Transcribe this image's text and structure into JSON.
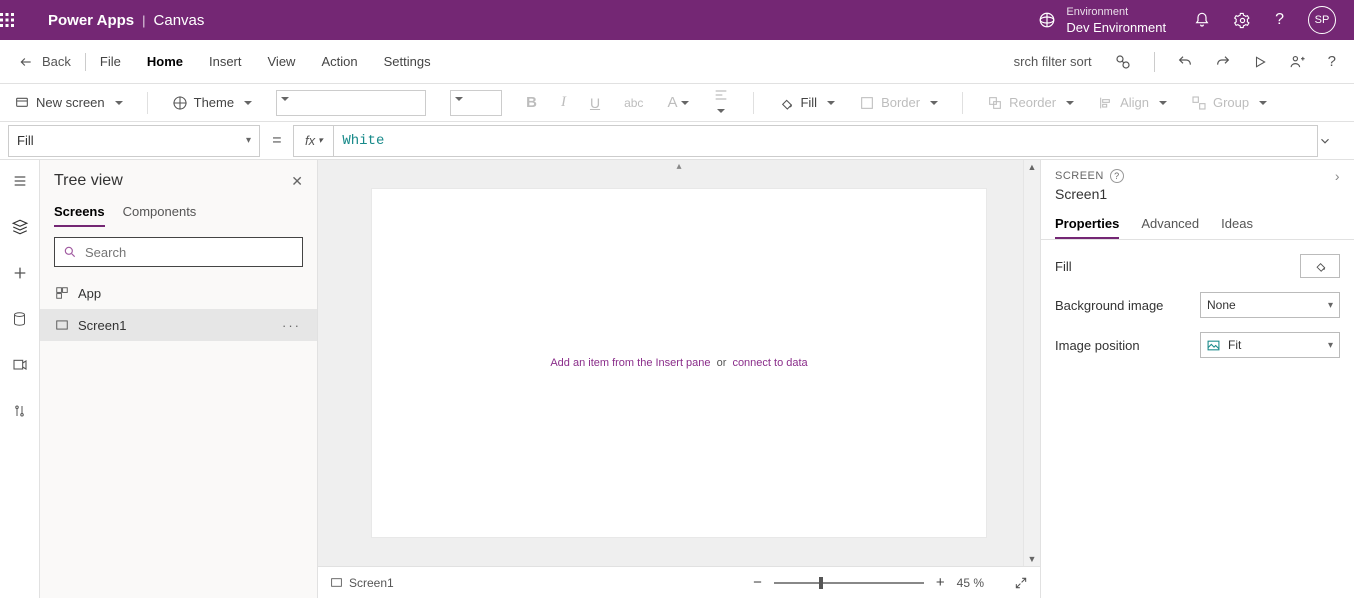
{
  "header": {
    "app": "Power Apps",
    "sub": "Canvas",
    "env_label": "Environment",
    "env_name": "Dev Environment",
    "avatar": "SP"
  },
  "menu": {
    "back": "Back",
    "items": [
      "File",
      "Home",
      "Insert",
      "View",
      "Action",
      "Settings"
    ],
    "active": "Home",
    "search_hint": "srch filter sort"
  },
  "ribbon": {
    "new_screen": "New screen",
    "theme": "Theme",
    "fill": "Fill",
    "border": "Border",
    "reorder": "Reorder",
    "align": "Align",
    "group": "Group"
  },
  "formula": {
    "property": "Fill",
    "value": "White"
  },
  "tree": {
    "title": "Tree view",
    "tabs": [
      "Screens",
      "Components"
    ],
    "active_tab": "Screens",
    "search_placeholder": "Search",
    "items": [
      {
        "label": "App",
        "selected": false
      },
      {
        "label": "Screen1",
        "selected": true
      }
    ]
  },
  "canvas": {
    "hint_pre": "Add an item from the Insert pane",
    "hint_or": "or",
    "hint_link": "connect to data"
  },
  "status": {
    "screen": "Screen1",
    "zoom": "45  %"
  },
  "props": {
    "header": "SCREEN",
    "name": "Screen1",
    "tabs": [
      "Properties",
      "Advanced",
      "Ideas"
    ],
    "active_tab": "Properties",
    "rows": {
      "fill_label": "Fill",
      "bg_label": "Background image",
      "bg_value": "None",
      "pos_label": "Image position",
      "pos_value": "Fit"
    }
  }
}
